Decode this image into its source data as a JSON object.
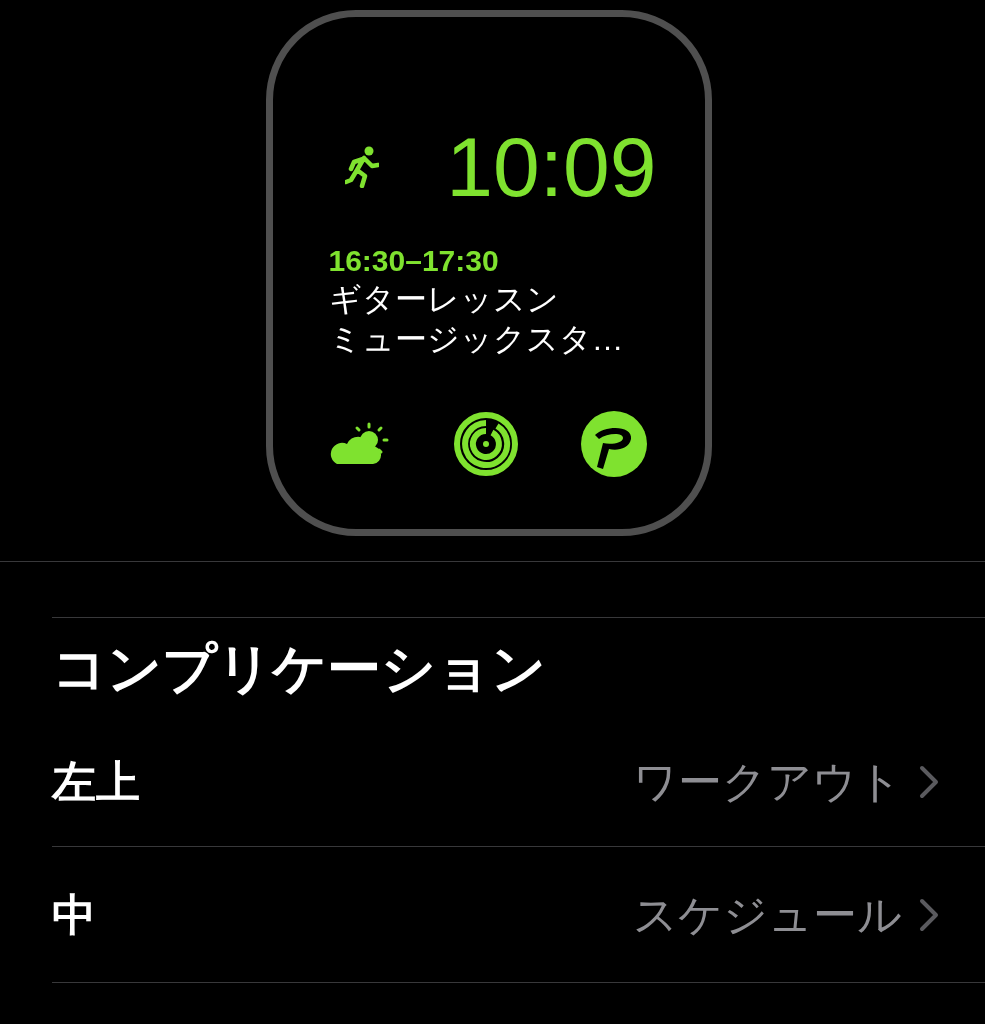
{
  "watch_face": {
    "time": "10:09",
    "event": {
      "time": "16:30–17:30",
      "title": "ギターレッスン",
      "location": "ミュージックスタ…"
    }
  },
  "complications": {
    "heading": "コンプリケーション",
    "rows": [
      {
        "label": "左上",
        "value": "ワークアウト"
      },
      {
        "label": "中",
        "value": "スケジュール"
      }
    ]
  }
}
